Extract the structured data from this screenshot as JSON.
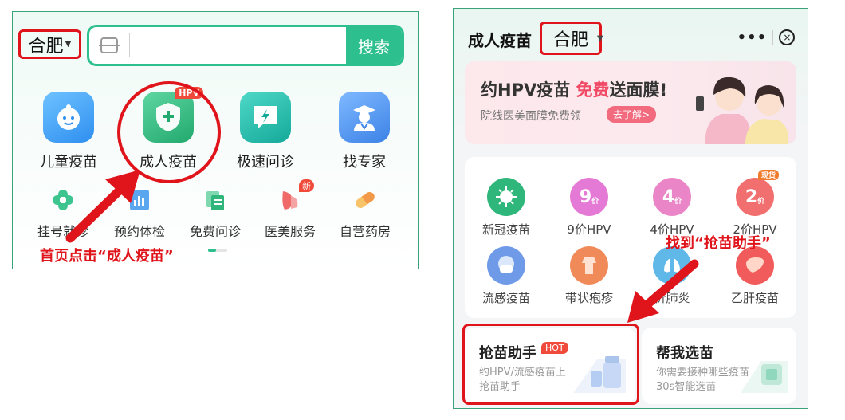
{
  "left_panel": {
    "city": "合肥",
    "search_button": "搜索",
    "main_icons": [
      {
        "label": "儿童疫苗",
        "icon": "baby-face-icon",
        "badge": ""
      },
      {
        "label": "成人疫苗",
        "icon": "shield-plus-icon",
        "badge": "HPV"
      },
      {
        "label": "极速问诊",
        "icon": "chat-lightning-icon",
        "badge": ""
      },
      {
        "label": "找专家",
        "icon": "doctor-icon",
        "badge": ""
      }
    ],
    "small_icons": [
      {
        "label": "挂号就诊",
        "icon": "clover-icon",
        "badge": ""
      },
      {
        "label": "预约体检",
        "icon": "report-chart-icon",
        "badge": ""
      },
      {
        "label": "免费问诊",
        "icon": "stacked-docs-icon",
        "badge": ""
      },
      {
        "label": "医美服务",
        "icon": "beauty-face-icon",
        "badge": "新"
      },
      {
        "label": "自营药房",
        "icon": "pill-icon",
        "badge": ""
      }
    ],
    "instruction": "首页点击“成人疫苗”"
  },
  "right_panel": {
    "title": "成人疫苗",
    "city": "合肥",
    "banner": {
      "title_pre": "约HPV疫苗 ",
      "title_highlight": "免费",
      "title_post": "送面膜!",
      "subtitle": "院线医美面膜免费领",
      "button": "去了解>"
    },
    "vaccines": [
      {
        "label": "新冠疫苗",
        "icon": "virus-icon",
        "digit": "",
        "unit": "",
        "badge": "",
        "color": "#2fb67a"
      },
      {
        "label": "9价HPV",
        "icon": "hpv-9-icon",
        "digit": "9",
        "unit": "价",
        "badge": "",
        "color": "#e57ad6"
      },
      {
        "label": "4价HPV",
        "icon": "hpv-4-icon",
        "digit": "4",
        "unit": "价",
        "badge": "",
        "color": "#ea86c8"
      },
      {
        "label": "2价HPV",
        "icon": "hpv-2-icon",
        "digit": "2",
        "unit": "价",
        "badge": "现货",
        "color": "#f16f6f"
      },
      {
        "label": "流感疫苗",
        "icon": "mask-face-icon",
        "digit": "",
        "unit": "",
        "badge": "",
        "color": "#6f9ae8"
      },
      {
        "label": "带状疱疹",
        "icon": "body-icon",
        "digit": "",
        "unit": "",
        "badge": "",
        "color": "#f08a58"
      },
      {
        "label": "价肺炎",
        "icon": "lungs-icon",
        "digit": "",
        "unit": "",
        "badge": "",
        "color": "#5fb8e8"
      },
      {
        "label": "乙肝疫苗",
        "icon": "liver-icon",
        "digit": "",
        "unit": "",
        "badge": "",
        "color": "#f25b5b"
      }
    ],
    "instruction": "找到“抢苗助手”",
    "cards": [
      {
        "title": "抢苗助手",
        "badge": "HOT",
        "sub": "约HPV/流感疫苗上抢苗助手"
      },
      {
        "title": "帮我选苗",
        "badge": "",
        "sub": "你需要接种哪些疫苗30s智能选苗"
      }
    ]
  },
  "colors": {
    "accent": "#2dbf8e",
    "annotation": "#e0151b",
    "hot": "#f04a3a"
  }
}
